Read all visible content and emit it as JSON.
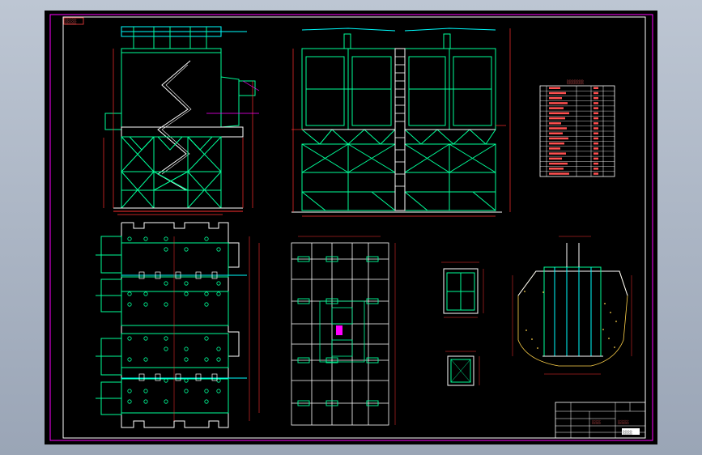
{
  "colors": {
    "background": "#a8b3c3",
    "paper": "#000000",
    "frame": "#ff00ff",
    "frame_inner": "#ffffff",
    "structure": "#00ff99",
    "struct_cyan": "#00ffff",
    "dimension": "#ff3030",
    "accent_yellow": "#ffd24a",
    "accent_magenta": "#ff00ff",
    "white": "#ffffff"
  },
  "drawing": {
    "top_left_tag": "░░░░",
    "title_block_name": "░░░░",
    "title_block_sign": "░░░░░",
    "title_block_stamp": "░░░░"
  },
  "parts_table": {
    "heading": "░░░░░░░",
    "rows": 18
  }
}
